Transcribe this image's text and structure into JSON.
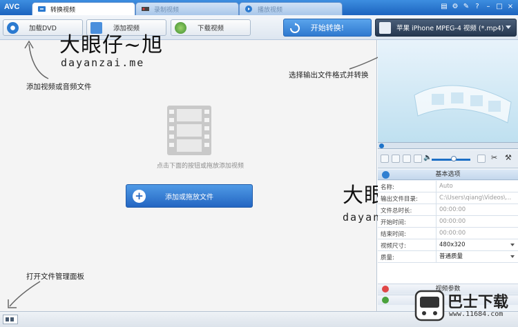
{
  "app": {
    "logo": "AVC"
  },
  "tabs": [
    {
      "label": "转换视频",
      "active": true
    },
    {
      "label": "录制视频",
      "active": false
    },
    {
      "label": "播放视频",
      "active": false
    }
  ],
  "window_buttons": {
    "help": "?",
    "minimize": "–",
    "maximize": "□",
    "close": "×"
  },
  "toolbar": {
    "add_dvd": "加载DVD",
    "add_video": "添加视频",
    "download_video": "下载视频",
    "convert": "开始转换!",
    "format": "苹果 iPhone MPEG-4 视频 (*.mp4)"
  },
  "main": {
    "hint": "点击下面的按钮或拖放添加视频",
    "add_button": "添加或拖放文件"
  },
  "annotations": {
    "add_files": "添加视频或音频文件",
    "choose_format": "选择输出文件格式并转换",
    "open_panel": "打开文件管理面板"
  },
  "watermark": {
    "cn": "大眼仔~旭",
    "en": "dayanzai.me"
  },
  "props": {
    "header": "基本选项",
    "rows": [
      {
        "key": "名称:",
        "value": "Auto",
        "dropdown": false
      },
      {
        "key": "输出文件目录:",
        "value": "C:\\Users\\qiang\\Videos\\...",
        "dropdown": false
      },
      {
        "key": "文件总时长:",
        "value": "00:00:00",
        "dropdown": false
      },
      {
        "key": "开始时间:",
        "value": "00:00:00",
        "dropdown": false
      },
      {
        "key": "结束时间:",
        "value": "00:00:00",
        "dropdown": false
      },
      {
        "key": "视频尺寸:",
        "value": "480x320",
        "dropdown": true
      },
      {
        "key": "质量:",
        "value": "普通质量",
        "dropdown": true
      }
    ],
    "video_params": "视频参数",
    "audio_params": ""
  },
  "site": {
    "cn": "巴士下载",
    "url": "www.11684.com"
  },
  "colors": {
    "accent": "#2f79cf",
    "title": "#1c63bf"
  }
}
